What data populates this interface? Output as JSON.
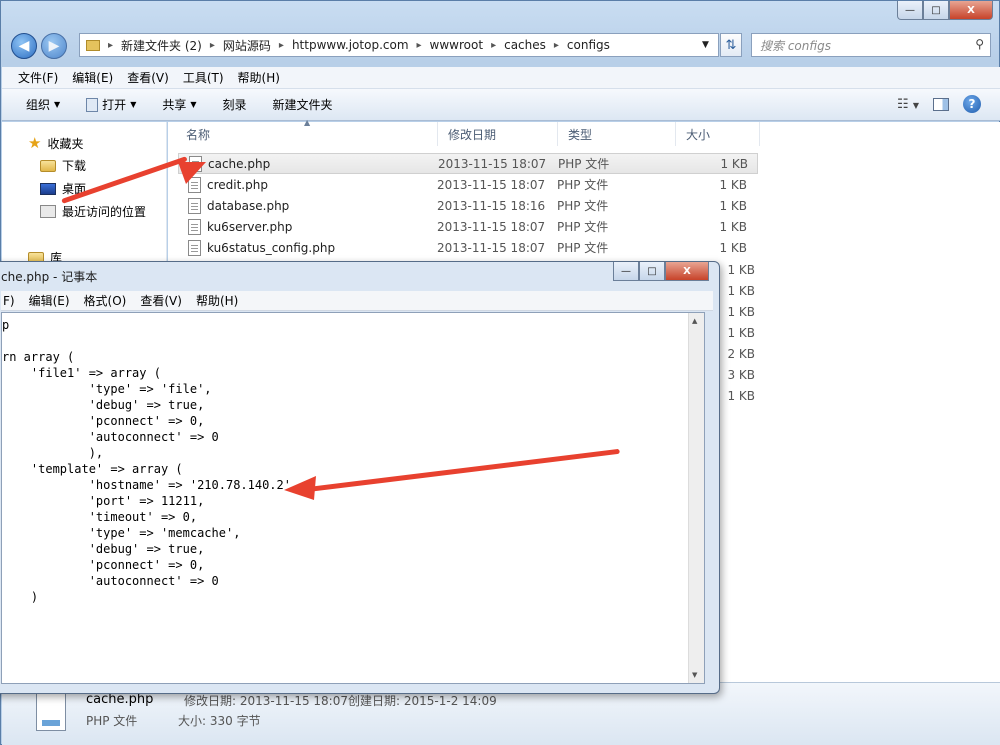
{
  "explorer": {
    "window_controls": {
      "minimize": "—",
      "maximize": "□",
      "close": "X"
    },
    "breadcrumb": [
      "新建文件夹 (2)",
      "网站源码",
      "httpwww.jotop.com",
      "wwwroot",
      "caches",
      "configs"
    ],
    "search_placeholder": "搜索 configs",
    "menu": [
      "文件(F)",
      "编辑(E)",
      "查看(V)",
      "工具(T)",
      "帮助(H)"
    ],
    "toolbar": {
      "organize": "组织",
      "open": "打开",
      "share": "共享",
      "burn": "刻录",
      "new_folder": "新建文件夹"
    },
    "nav": {
      "favorites": "收藏夹",
      "downloads": "下载",
      "desktop": "桌面",
      "recent": "最近访问的位置",
      "libraries": "库"
    },
    "columns": {
      "name": "名称",
      "date": "修改日期",
      "type": "类型",
      "size": "大小"
    },
    "files": [
      {
        "name": "cache.php",
        "date": "2013-11-15 18:07",
        "type": "PHP 文件",
        "size": "1 KB"
      },
      {
        "name": "credit.php",
        "date": "2013-11-15 18:07",
        "type": "PHP 文件",
        "size": "1 KB"
      },
      {
        "name": "database.php",
        "date": "2013-11-15 18:16",
        "type": "PHP 文件",
        "size": "1 KB"
      },
      {
        "name": "ku6server.php",
        "date": "2013-11-15 18:07",
        "type": "PHP 文件",
        "size": "1 KB"
      },
      {
        "name": "ku6status_config.php",
        "date": "2013-11-15 18:07",
        "type": "PHP 文件",
        "size": "1 KB"
      }
    ],
    "hidden_sizes": [
      "1 KB",
      "1 KB",
      "1 KB",
      "1 KB",
      "2 KB",
      "3 KB",
      "1 KB"
    ],
    "details": {
      "name": "cache.php",
      "modified": "修改日期: 2013-11-15 18:07",
      "created": "创建日期: 2015-1-2 14:09",
      "type": "PHP 文件",
      "size": "大小: 330 字节"
    }
  },
  "notepad": {
    "title": "che.php - 记事本",
    "menu": [
      "F)",
      "编辑(E)",
      "格式(O)",
      "查看(V)",
      "帮助(H)"
    ],
    "code": "p\n\nrn array (\n    'file1' => array (\n            'type' => 'file',\n            'debug' => true,\n            'pconnect' => 0,\n            'autoconnect' => 0\n            ),\n    'template' => array (\n            'hostname' => '210.78.140.2',\n            'port' => 11211,\n            'timeout' => 0,\n            'type' => 'memcache',\n            'debug' => true,\n            'pconnect' => 0,\n            'autoconnect' => 0\n    )"
  },
  "colors": {
    "arrow": "#e8412f",
    "selection": "#e6e6e6"
  }
}
